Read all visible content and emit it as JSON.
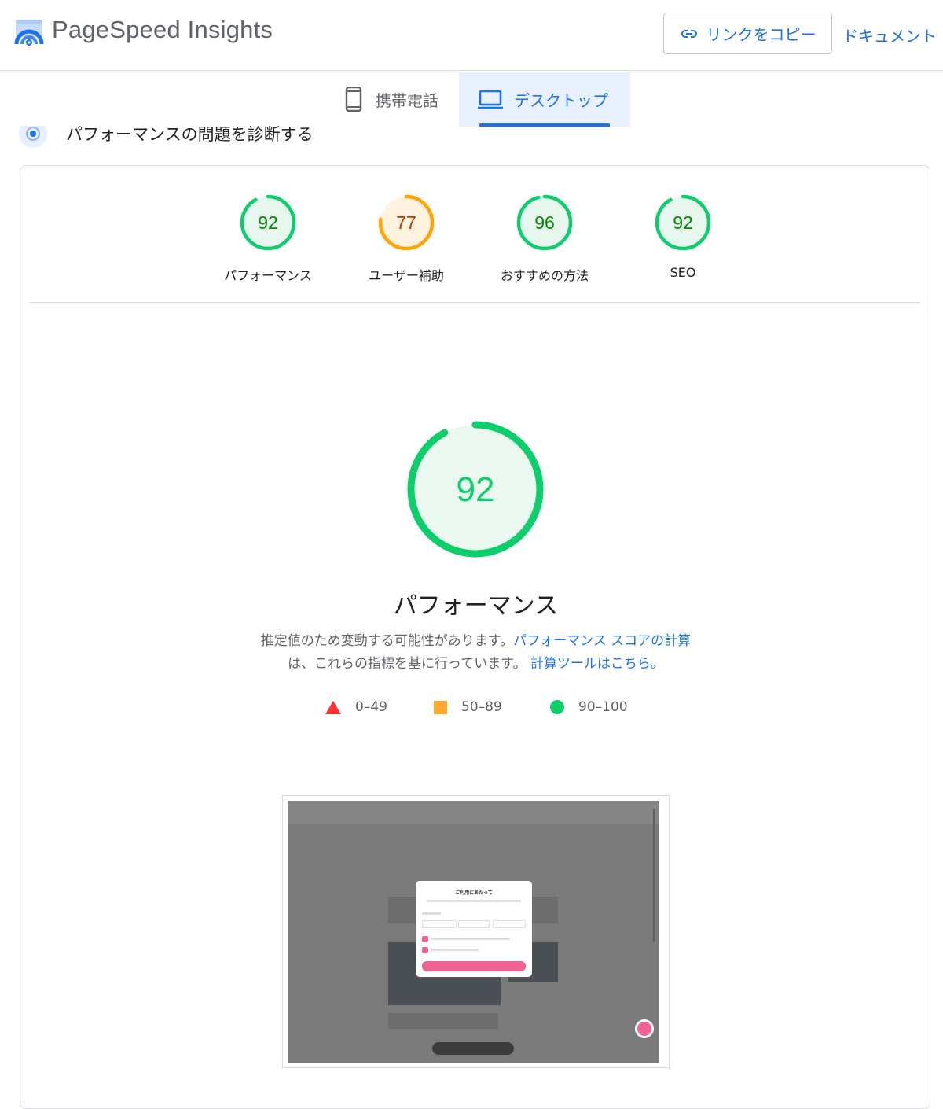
{
  "header": {
    "title": "PageSpeed Insights",
    "copy_link": "リンクをコピー",
    "docs": "ドキュメント"
  },
  "tabs": [
    {
      "label": "携帯電話",
      "icon": "smartphone-icon",
      "active": false
    },
    {
      "label": "デスクトップ",
      "icon": "laptop-icon",
      "active": true
    }
  ],
  "diagnose_heading": "パフォーマンスの問題を診断する",
  "scores": [
    {
      "label": "パフォーマンス",
      "value": "92",
      "level": 0.92,
      "color": "#0cce6b",
      "text_color": "#008800",
      "fill": "#e7f7ee"
    },
    {
      "label": "ユーザー補助",
      "value": "77",
      "level": 0.77,
      "color": "#ffa400",
      "text_color": "#c33300",
      "fill": "#fff3e0"
    },
    {
      "label": "おすすめの方法",
      "value": "96",
      "level": 0.96,
      "color": "#0cce6b",
      "text_color": "#008800",
      "fill": "#e7f7ee"
    },
    {
      "label": "SEO",
      "value": "92",
      "level": 0.92,
      "color": "#0cce6b",
      "text_color": "#008800",
      "fill": "#e7f7ee"
    }
  ],
  "main_score": {
    "value": "92",
    "level": 0.92,
    "title": "パフォーマンス",
    "color": "#0cce6b",
    "text_color": "#0cce6b",
    "fill": "#eaf8ef"
  },
  "description": {
    "part1": "推定値のため変動する可能性があります。",
    "link1": "パフォーマンス スコアの計算",
    "part2": "は、これらの指標を基に行っています。",
    "link2": "計算ツールはこちら。"
  },
  "legend": [
    {
      "range": "0–49",
      "shape": "triangle",
      "color": "#ff3333"
    },
    {
      "range": "50–89",
      "shape": "square",
      "color": "#ffaa33"
    },
    {
      "range": "90–100",
      "shape": "circle",
      "color": "#0cce6b"
    }
  ],
  "screenshot": {
    "modal_title": "ご利用にあたって"
  }
}
